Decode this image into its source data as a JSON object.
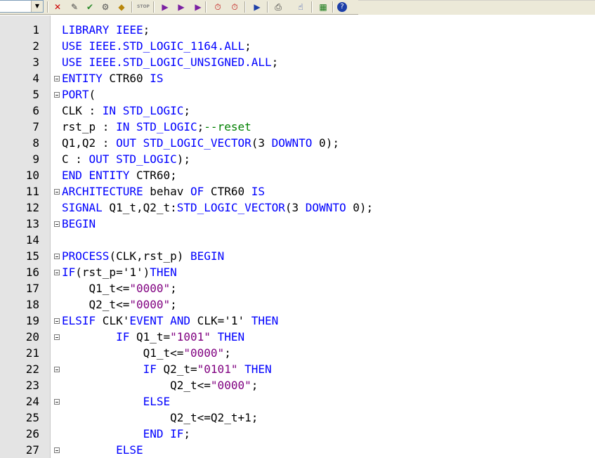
{
  "toolbar": {
    "combo_value": "",
    "buttons": [
      {
        "name": "select-icon",
        "glyph": "✕"
      },
      {
        "name": "edit-pen-icon",
        "glyph": "✎"
      },
      {
        "name": "check-icon",
        "glyph": "✔"
      },
      {
        "name": "compile-icon",
        "glyph": "⚙"
      },
      {
        "name": "diamond-icon",
        "glyph": "◆"
      },
      {
        "name": "stop-icon",
        "glyph": "STOP"
      },
      {
        "name": "run-icon",
        "glyph": "▶"
      },
      {
        "name": "run-step-icon",
        "glyph": "▶"
      },
      {
        "name": "run-break-icon",
        "glyph": "▶"
      },
      {
        "name": "clock-icon",
        "glyph": "⏱"
      },
      {
        "name": "timer-icon",
        "glyph": "⏱"
      },
      {
        "name": "pointer-icon",
        "glyph": "▶"
      },
      {
        "name": "print-icon",
        "glyph": "⎙"
      },
      {
        "name": "hand-icon",
        "glyph": "☝"
      },
      {
        "name": "chip-icon",
        "glyph": "▦"
      },
      {
        "name": "help-icon",
        "glyph": "?"
      }
    ]
  },
  "editor": {
    "colors": {
      "keyword": "#0000ff",
      "string": "#800080",
      "comment": "#008000",
      "plain": "#000000"
    },
    "lines": [
      {
        "n": "1",
        "fold": false,
        "indent": "",
        "tokens": [
          [
            "kw",
            "LIBRARY IEEE"
          ],
          [
            "pl",
            ";"
          ]
        ]
      },
      {
        "n": "2",
        "fold": false,
        "indent": "",
        "tokens": [
          [
            "kw",
            "USE IEEE.STD_LOGIC_1164.ALL"
          ],
          [
            "pl",
            ";"
          ]
        ]
      },
      {
        "n": "3",
        "fold": false,
        "indent": "",
        "tokens": [
          [
            "kw",
            "USE IEEE.STD_LOGIC_UNSIGNED.ALL"
          ],
          [
            "pl",
            ";"
          ]
        ]
      },
      {
        "n": "4",
        "fold": true,
        "indent": "",
        "tokens": [
          [
            "kw",
            "ENTITY"
          ],
          [
            "pl",
            " CTR60 "
          ],
          [
            "kw",
            "IS"
          ]
        ]
      },
      {
        "n": "5",
        "fold": true,
        "indent": "",
        "tokens": [
          [
            "kw",
            "PORT"
          ],
          [
            "pl",
            "("
          ]
        ]
      },
      {
        "n": "6",
        "fold": false,
        "indent": "",
        "tokens": [
          [
            "pl",
            "CLK : "
          ],
          [
            "kw",
            "IN STD_LOGIC"
          ],
          [
            "pl",
            ";"
          ]
        ]
      },
      {
        "n": "7",
        "fold": false,
        "indent": "",
        "tokens": [
          [
            "pl",
            "rst_p : "
          ],
          [
            "kw",
            "IN STD_LOGIC"
          ],
          [
            "pl",
            ";"
          ],
          [
            "cm",
            "--reset"
          ]
        ]
      },
      {
        "n": "8",
        "fold": false,
        "indent": "",
        "tokens": [
          [
            "pl",
            "Q1,Q2 : "
          ],
          [
            "kw",
            "OUT STD_LOGIC_VECTOR"
          ],
          [
            "pl",
            "(3 "
          ],
          [
            "kw",
            "DOWNTO"
          ],
          [
            "pl",
            " 0);"
          ]
        ]
      },
      {
        "n": "9",
        "fold": false,
        "indent": "",
        "tokens": [
          [
            "pl",
            "C : "
          ],
          [
            "kw",
            "OUT STD_LOGIC"
          ],
          [
            "pl",
            ");"
          ]
        ]
      },
      {
        "n": "10",
        "fold": false,
        "indent": "",
        "tokens": [
          [
            "kw",
            "END ENTITY"
          ],
          [
            "pl",
            " CTR60;"
          ]
        ]
      },
      {
        "n": "11",
        "fold": true,
        "indent": "",
        "tokens": [
          [
            "kw",
            "ARCHITECTURE"
          ],
          [
            "pl",
            " behav "
          ],
          [
            "kw",
            "OF"
          ],
          [
            "pl",
            " CTR60 "
          ],
          [
            "kw",
            "IS"
          ]
        ]
      },
      {
        "n": "12",
        "fold": false,
        "indent": "",
        "tokens": [
          [
            "kw",
            "SIGNAL"
          ],
          [
            "pl",
            " Q1_t,Q2_t:"
          ],
          [
            "kw",
            "STD_LOGIC_VECTOR"
          ],
          [
            "pl",
            "(3 "
          ],
          [
            "kw",
            "DOWNTO"
          ],
          [
            "pl",
            " 0);"
          ]
        ]
      },
      {
        "n": "13",
        "fold": true,
        "indent": "",
        "tokens": [
          [
            "kw",
            "BEGIN"
          ]
        ]
      },
      {
        "n": "14",
        "fold": false,
        "indent": "",
        "tokens": []
      },
      {
        "n": "15",
        "fold": true,
        "indent": "",
        "tokens": [
          [
            "kw",
            "PROCESS"
          ],
          [
            "pl",
            "(CLK,rst_p) "
          ],
          [
            "kw",
            "BEGIN"
          ]
        ]
      },
      {
        "n": "16",
        "fold": true,
        "indent": "",
        "tokens": [
          [
            "kw",
            "IF"
          ],
          [
            "pl",
            "(rst_p='1')"
          ],
          [
            "kw",
            "THEN"
          ]
        ]
      },
      {
        "n": "17",
        "fold": false,
        "indent": "    ",
        "tokens": [
          [
            "pl",
            "Q1_t<="
          ],
          [
            "str",
            "\"0000\""
          ],
          [
            "pl",
            ";"
          ]
        ]
      },
      {
        "n": "18",
        "fold": false,
        "indent": "    ",
        "tokens": [
          [
            "pl",
            "Q2_t<="
          ],
          [
            "str",
            "\"0000\""
          ],
          [
            "pl",
            ";"
          ]
        ]
      },
      {
        "n": "19",
        "fold": true,
        "indent": "",
        "tokens": [
          [
            "kw",
            "ELSIF"
          ],
          [
            "pl",
            " CLK'"
          ],
          [
            "kw",
            "EVENT AND"
          ],
          [
            "pl",
            " CLK='1' "
          ],
          [
            "kw",
            "THEN"
          ]
        ]
      },
      {
        "n": "20",
        "fold": true,
        "indent": "        ",
        "tokens": [
          [
            "kw",
            "IF"
          ],
          [
            "pl",
            " Q1_t="
          ],
          [
            "str",
            "\"1001\""
          ],
          [
            "pl",
            " "
          ],
          [
            "kw",
            "THEN"
          ]
        ]
      },
      {
        "n": "21",
        "fold": false,
        "indent": "            ",
        "tokens": [
          [
            "pl",
            "Q1_t<="
          ],
          [
            "str",
            "\"0000\""
          ],
          [
            "pl",
            ";"
          ]
        ]
      },
      {
        "n": "22",
        "fold": true,
        "indent": "            ",
        "tokens": [
          [
            "kw",
            "IF"
          ],
          [
            "pl",
            " Q2_t="
          ],
          [
            "str",
            "\"0101\""
          ],
          [
            "pl",
            " "
          ],
          [
            "kw",
            "THEN"
          ]
        ]
      },
      {
        "n": "23",
        "fold": false,
        "indent": "                ",
        "tokens": [
          [
            "pl",
            "Q2_t<="
          ],
          [
            "str",
            "\"0000\""
          ],
          [
            "pl",
            ";"
          ]
        ]
      },
      {
        "n": "24",
        "fold": true,
        "indent": "            ",
        "tokens": [
          [
            "kw",
            "ELSE"
          ]
        ]
      },
      {
        "n": "25",
        "fold": false,
        "indent": "                ",
        "tokens": [
          [
            "pl",
            "Q2_t<=Q2_t+1;"
          ]
        ]
      },
      {
        "n": "26",
        "fold": false,
        "indent": "            ",
        "tokens": [
          [
            "kw",
            "END IF"
          ],
          [
            "pl",
            ";"
          ]
        ]
      },
      {
        "n": "27",
        "fold": true,
        "indent": "        ",
        "tokens": [
          [
            "kw",
            "ELSE"
          ]
        ]
      }
    ]
  }
}
